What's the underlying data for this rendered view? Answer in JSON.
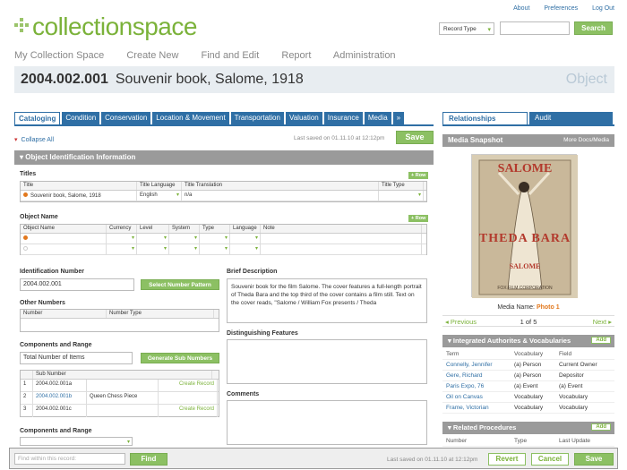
{
  "header": {
    "logo_a": "collection",
    "logo_b": "space",
    "links": [
      "About",
      "Preferences",
      "Log Out"
    ],
    "record_type": "Record Type",
    "search_label": "Search"
  },
  "nav": [
    "My Collection Space",
    "Create New",
    "Find and Edit",
    "Report",
    "Administration"
  ],
  "record": {
    "id": "2004.002.001",
    "title": "Souvenir book, Salome, 1918",
    "type": "Object"
  },
  "tabs": [
    "Cataloging",
    "Condition",
    "Conservation",
    "Location & Movement",
    "Transportation",
    "Valuation",
    "Insurance",
    "Media",
    "»"
  ],
  "rtabs": [
    "Relationships",
    "Audit"
  ],
  "toolbar": {
    "collapse": "Collapse All",
    "last_saved": "Last saved on 01.11.10 at 12:12pm",
    "save": "Save"
  },
  "section": "Object Identification Information",
  "titles": {
    "label": "Titles",
    "add": "+ Row",
    "cols": [
      "Title",
      "Title Language",
      "Title Translation",
      "Title Type"
    ],
    "row": {
      "title": "Souvenir book, Salome, 1918",
      "lang": "English",
      "translation": "n/a"
    }
  },
  "object_name": {
    "label": "Object Name",
    "add": "+ Row",
    "cols": [
      "Object Name",
      "Currency",
      "Level",
      "System",
      "Type",
      "Language",
      "Note"
    ]
  },
  "identification": {
    "label": "Identification Number",
    "value": "2004.002.001",
    "button": "Select Number Pattern"
  },
  "other_numbers": {
    "label": "Other Numbers",
    "cols": [
      "Number",
      "Number Type"
    ]
  },
  "components": {
    "label": "Components and Range",
    "total_label": "Total Number of Items",
    "button": "Generate Sub Numbers",
    "sub_label": "Sub Number",
    "rows": [
      {
        "n": "1",
        "num": "2004.002.001a",
        "desc": "",
        "action": "Create Record"
      },
      {
        "n": "2",
        "num": "2004.002.001b",
        "desc": "Queen Chess Piece",
        "action": ""
      },
      {
        "n": "3",
        "num": "2004.002.001c",
        "desc": "",
        "action": "Create Record"
      }
    ],
    "label2": "Components and Range"
  },
  "brief": {
    "label": "Brief Description",
    "text": "Souvenir book for the film Salome. The cover features a full-length portrait of Theda Bara and the top third of the cover contains a film still. Text on the cover reads, \"Salome / William Fox presents / Theda"
  },
  "distinguishing": {
    "label": "Distinguishing Features"
  },
  "comments": {
    "label": "Comments"
  },
  "media": {
    "title": "Media Snapshot",
    "more": "More Docs/Media",
    "poster_top": "SALOME",
    "poster_mid": "THEDA BARA",
    "poster_bottom": "SALOME",
    "poster_foot": "FOX FILM CORPORATION",
    "name_label": "Media Name:",
    "name_value": "Photo 1",
    "prev": "◂ Previous",
    "count": "1 of 5",
    "next": "Next ▸"
  },
  "authorities": {
    "title": "Integrated Authorites & Vocabularies",
    "add": "Add",
    "cols": [
      "Term",
      "Vocabulary",
      "Field"
    ],
    "rows": [
      [
        "Connelly, Jennifer",
        "(a) Person",
        "Current Owner"
      ],
      [
        "Gere, Richard",
        "(a) Person",
        "Depositor"
      ],
      [
        "Paris Expo, 76",
        "(a) Event",
        "(a) Event"
      ],
      [
        "Oil on Canvas",
        "Vocabulary",
        "Vocabulary"
      ],
      [
        "Frame, Victorian",
        "Vocabulary",
        "Vocabulary"
      ]
    ]
  },
  "procedures": {
    "title": "Related Procedures",
    "add": "Add",
    "cols": [
      "Number",
      "Type",
      "Last Update"
    ]
  },
  "bottom": {
    "find_placeholder": "Find within this record:",
    "find": "Find",
    "last_saved": "Last saved on 01.11.10 at 12:12pm",
    "revert": "Revert",
    "cancel": "Cancel",
    "save": "Save"
  },
  "colors": {
    "green": "#8cc063",
    "blue": "#2f6fa5",
    "orange": "#e2781d",
    "gray": "#9a9a9a"
  }
}
